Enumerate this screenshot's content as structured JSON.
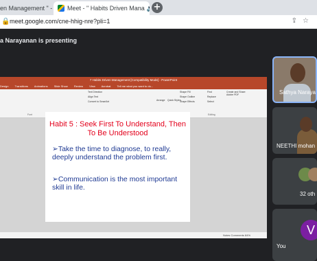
{
  "browser": {
    "tabs": [
      {
        "label": "en Management \" - "
      },
      {
        "label": "Meet - \" Habits Driven Mana"
      }
    ],
    "url": "meet.google.com/cne-hhig-nre?pli=1"
  },
  "meet": {
    "presenting_banner": "a Narayanan is presenting"
  },
  "powerpoint": {
    "title_bar": "7 Habits Driven Management [Compatibility Mode] - PowerPoint",
    "ribbon_tabs": [
      "Design",
      "Transitions",
      "Animations",
      "Slide Show",
      "Review",
      "View",
      "Acrobat",
      "Tell me what you want to do..."
    ],
    "ribbon_groups": [
      "Font",
      "Paragraph",
      "Drawing",
      "Editing"
    ],
    "ribbon_buttons": [
      "Text Direction",
      "Align Text",
      "Convert to SmartArt",
      "Arrange",
      "Quick Styles",
      "Shape Fill",
      "Shape Outline",
      "Shape Effects",
      "Find",
      "Replace",
      "Select",
      "Create and Share Adobe PDF"
    ],
    "status_left": "",
    "status_right": "Notes   Comments   84%",
    "slide": {
      "title": "Habit 5 : Seek First To Understand, Then To Be Understood",
      "bullets": [
        "Take the time to diagnose, to really, deeply understand the problem first.",
        "Communication is the most important skill in life."
      ]
    }
  },
  "participants": [
    {
      "name": "Sathya Narayan"
    },
    {
      "name": "NEETHI mohan"
    },
    {
      "name": "32 oth"
    },
    {
      "name": "You",
      "initial": "V"
    }
  ]
}
